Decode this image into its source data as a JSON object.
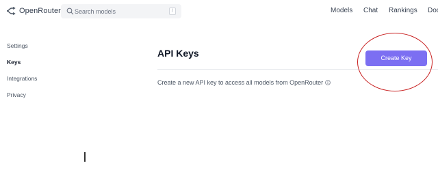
{
  "header": {
    "brand": "OpenRouter",
    "search_placeholder": "Search models",
    "search_shortcut": "/",
    "nav": [
      "Models",
      "Chat",
      "Rankings",
      "Doc"
    ]
  },
  "sidebar": {
    "items": [
      {
        "label": "Settings",
        "active": false
      },
      {
        "label": "Keys",
        "active": true
      },
      {
        "label": "Integrations",
        "active": false
      },
      {
        "label": "Privacy",
        "active": false
      }
    ]
  },
  "main": {
    "title": "API Keys",
    "description": "Create a new API key to access all models from OpenRouter",
    "create_button": "Create Key"
  },
  "colors": {
    "accent": "#7c6ff2",
    "annotation": "#c81e1e"
  },
  "icons": {
    "logo": "openrouter-logo-icon",
    "search": "search-icon",
    "info": "info-icon"
  }
}
